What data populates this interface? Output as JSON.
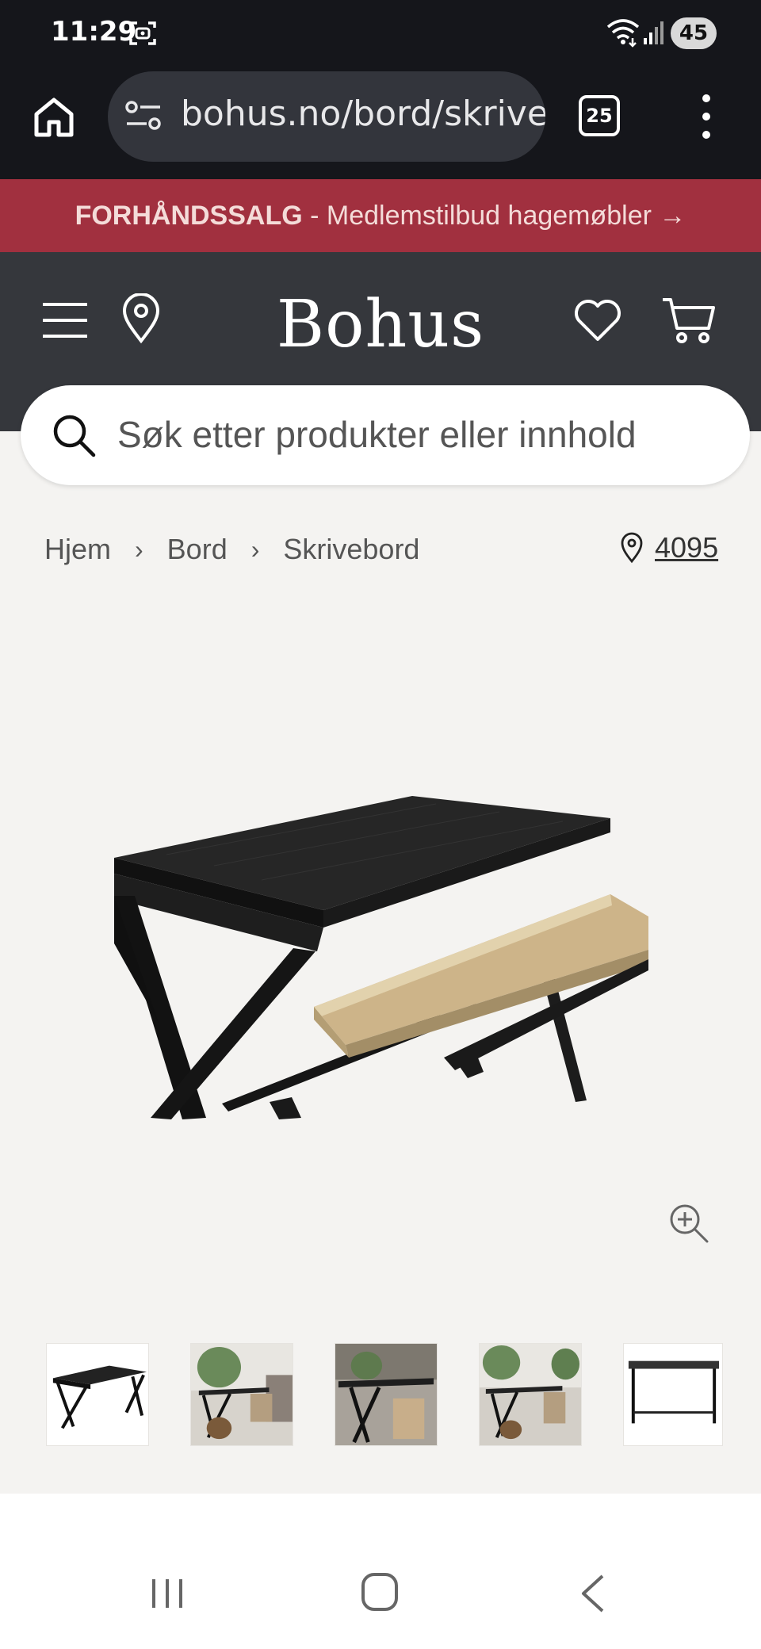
{
  "status_bar": {
    "time": "11:29",
    "battery": "45"
  },
  "browser": {
    "url": "bohus.no/bord/skrivebord",
    "tab_count": "25"
  },
  "promo": {
    "bold": "FORHÅNDSSALG",
    "text": " - Medlemstilbud hagemøbler →",
    "background_color": "#a1303f"
  },
  "header": {
    "logo": "Bohus",
    "background_color": "#35373c"
  },
  "search": {
    "placeholder": "Søk etter produkter eller innhold"
  },
  "breadcrumb": {
    "items": [
      "Hjem",
      "Bord",
      "Skrivebord"
    ],
    "separator": "›"
  },
  "store": {
    "code": "4095"
  },
  "gallery": {
    "thumbnail_count": 5
  }
}
